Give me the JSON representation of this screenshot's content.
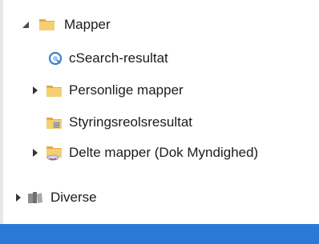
{
  "tree": {
    "root": {
      "label": "Mapper",
      "expanded": true,
      "icon": "folder-icon"
    },
    "items": [
      {
        "label": "cSearch-resultat",
        "icon": "search-result-icon",
        "expandable": false
      },
      {
        "label": "Personlige mapper",
        "icon": "folder-icon",
        "expandable": true,
        "expanded": false
      },
      {
        "label": "Styringsreolsresultat",
        "icon": "shelf-result-folder-icon",
        "expandable": false
      },
      {
        "label": "Delte mapper (Dok Myndighed)",
        "icon": "shared-folder-icon",
        "expandable": true,
        "expanded": false
      }
    ],
    "sibling": {
      "label": "Diverse",
      "icon": "miscellaneous-icon",
      "expandable": true,
      "expanded": false
    }
  },
  "colors": {
    "status_bar": "#2b79d6",
    "folder": "#f3c969",
    "folder_dark": "#e0ac3f",
    "search_icon": "#3b82c4"
  }
}
